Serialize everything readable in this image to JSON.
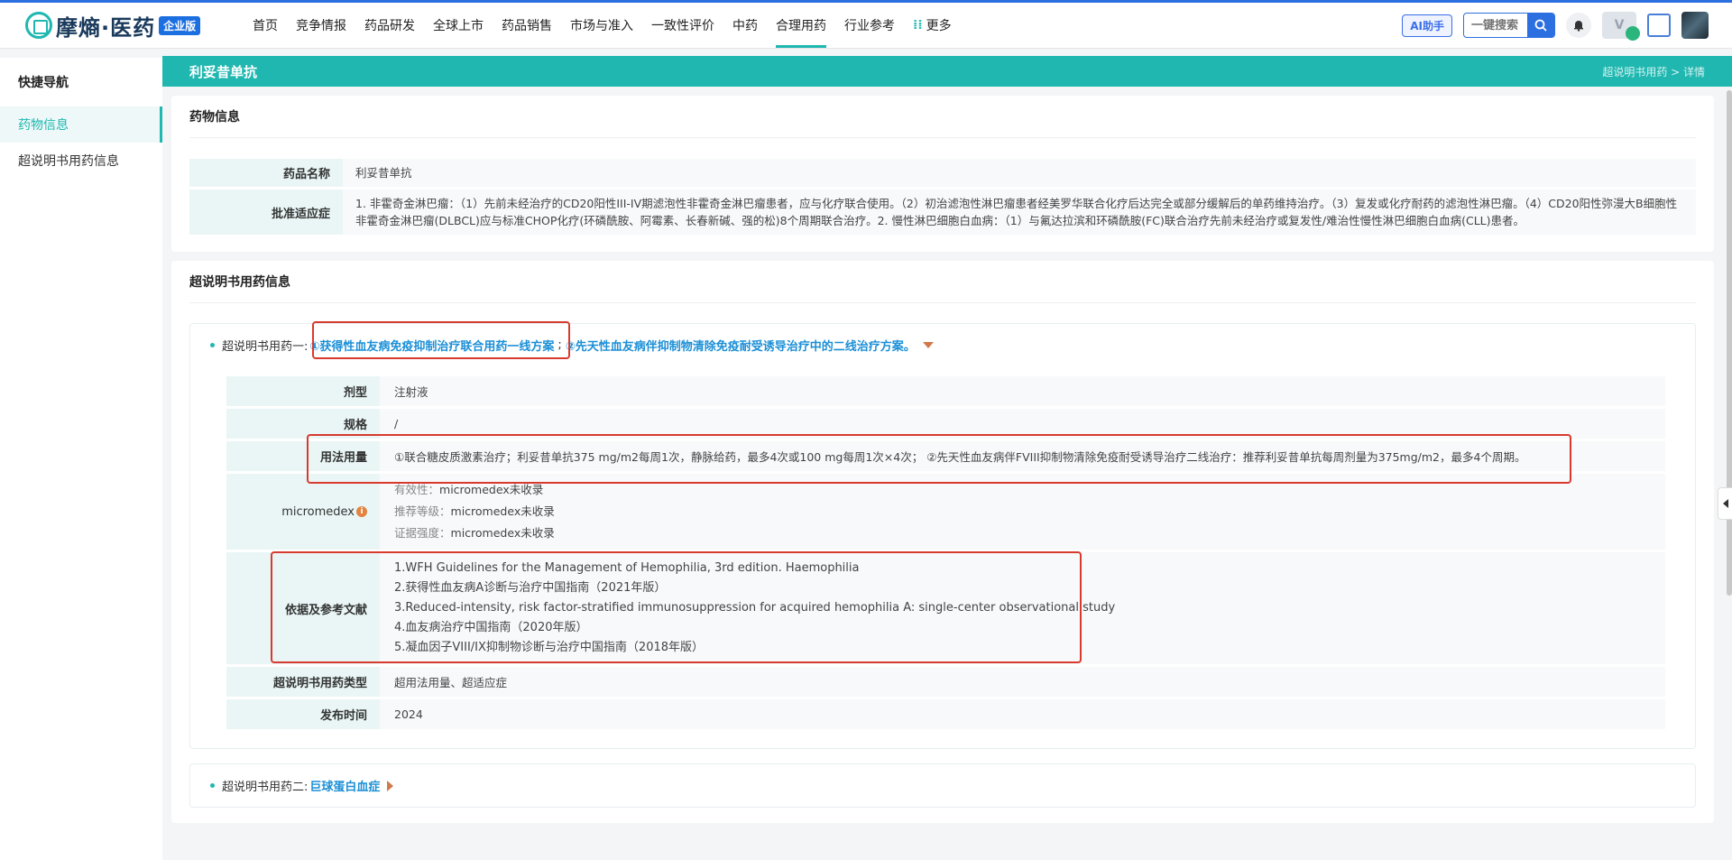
{
  "app": {
    "logo_text": "摩熵·医药",
    "edition_badge": "企业版"
  },
  "nav": {
    "items": [
      "首页",
      "竞争情报",
      "药品研发",
      "全球上市",
      "药品销售",
      "市场与准入",
      "一致性评价",
      "中药",
      "合理用药",
      "行业参考",
      "更多"
    ],
    "active": "合理用药"
  },
  "toolbar": {
    "ai_label": "AI助手",
    "search_placeholder": "一键搜索"
  },
  "sidebar": {
    "title": "快捷导航",
    "items": [
      "药物信息",
      "超说明书用药信息"
    ]
  },
  "header": {
    "title": "利妥昔单抗",
    "breadcrumb": "超说明书用药 > 详情"
  },
  "drug_info": {
    "section_title": "药物信息",
    "name_label": "药品名称",
    "name_value": "利妥昔单抗",
    "indication_label": "批准适应症",
    "indication_value": "1. 非霍奇金淋巴瘤：（1）先前未经治疗的CD20阳性III-IV期滤泡性非霍奇金淋巴瘤患者，应与化疗联合使用。（2）初治滤泡性淋巴瘤患者经美罗华联合化疗后达完全或部分缓解后的单药维持治疗。（3）复发或化疗耐药的滤泡性淋巴瘤。（4）CD20阳性弥漫大B细胞性非霍奇金淋巴瘤(DLBCL)应与标准CHOP化疗(环磷酰胺、阿霉素、长春新碱、强的松)8个周期联合治疗。2. 慢性淋巴细胞白血病：（1）与氟达拉滨和环磷酰胺(FC)联合治疗先前未经治疗或复发性/难治性慢性淋巴细胞白血病(CLL)患者。"
  },
  "offlabel": {
    "section_title": "超说明书用药信息",
    "use1": {
      "prefix": "超说明书用药一:",
      "link1": "①获得性血友病免疫抑制治疗联合用药一线方案",
      "sep": ";",
      "link2": "②先天性血友病伴抑制物清除免疫耐受诱导治疗中的二线治疗方案。",
      "rows": {
        "dosage_form_label": "剂型",
        "dosage_form": "注射液",
        "spec_label": "规格",
        "spec": "/",
        "usage_label": "用法用量",
        "usage": "①联合糖皮质激素治疗；利妥昔单抗375 mg/m2每周1次，静脉给药，最多4次或100 mg每周1次×4次；  ②先天性血友病伴FVIII抑制物清除免疫耐受诱导治疗二线治疗：推荐利妥昔单抗每周剂量为375mg/m2，最多4个周期。",
        "micromedex_label": "micromedex",
        "efficacy_key": "有效性：",
        "efficacy": "micromedex未收录",
        "level_key": "推荐等级：",
        "level": "micromedex未收录",
        "evidence_key": "证据强度：",
        "evidence": "micromedex未收录",
        "refs_label": "依据及参考文献",
        "refs": [
          "1.WFH Guidelines for the Management of Hemophilia, 3rd edition. Haemophilia",
          "2.获得性血友病A诊断与治疗中国指南（2021年版）",
          "3.Reduced-intensity, risk factor-stratified immunosuppression for acquired hemophilia A: single-center observational study",
          "4.血友病治疗中国指南（2020年版）",
          "5.凝血因子VIII/IX抑制物诊断与治疗中国指南（2018年版）"
        ],
        "type_label": "超说明书用药类型",
        "type": "超用法用量、超适应症",
        "date_label": "发布时间",
        "date": "2024"
      }
    },
    "use2": {
      "prefix": "超说明书用药二:",
      "link": "巨球蛋白血症"
    }
  },
  "colors": {
    "brand": "#20b7b0",
    "link": "#1b8fd6",
    "highlight": "#d93a2f"
  }
}
